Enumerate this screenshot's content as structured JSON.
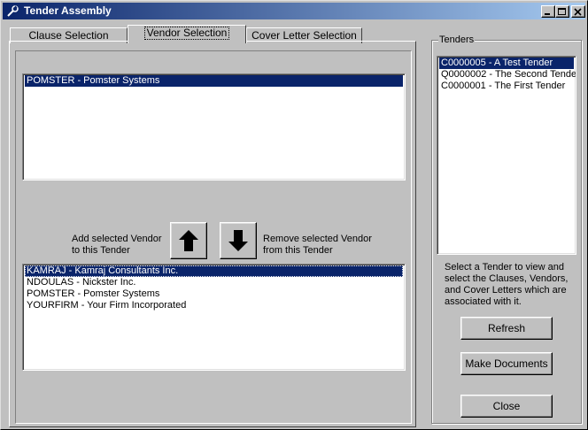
{
  "window": {
    "title": "Tender Assembly",
    "icon": "wrench-icon",
    "controls": {
      "minimize": "minimize-icon",
      "maximize": "maximize-icon",
      "close": "close-icon"
    }
  },
  "tabs": [
    {
      "label": "Clause Selection",
      "active": false
    },
    {
      "label": "Vendor Selection",
      "active": true
    },
    {
      "label": "Cover Letter Selection",
      "active": false
    }
  ],
  "vendor_tab": {
    "selected_vendors": [
      {
        "label": "POMSTER - Pomster Systems",
        "selected": true
      }
    ],
    "add_label_line1": "Add selected Vendor",
    "add_label_line2": "to this Tender",
    "remove_label_line1": "Remove selected Vendor",
    "remove_label_line2": "from this Tender",
    "add_button_icon": "arrow-up-icon",
    "remove_button_icon": "arrow-down-icon",
    "available_vendors": [
      {
        "label": "KAMRAJ - Kamraj Consultants Inc.",
        "selected": true
      },
      {
        "label": "NDOULAS - Nickster Inc.",
        "selected": false
      },
      {
        "label": "POMSTER - Pomster Systems",
        "selected": false
      },
      {
        "label": "YOURFIRM - Your Firm Incorporated",
        "selected": false
      }
    ]
  },
  "tenders": {
    "legend": "Tenders",
    "items": [
      {
        "label": "C0000005 - A Test Tender",
        "selected": true
      },
      {
        "label": "Q0000002 - The Second Tende",
        "selected": false
      },
      {
        "label": "C0000001 - The First Tender",
        "selected": false
      }
    ],
    "help_line1": "Select a Tender to view and",
    "help_line2": "select the Clauses, Vendors,",
    "help_line3": "and Cover Letters which are",
    "help_line4": "associated with it.",
    "refresh_label": "Refresh",
    "make_documents_label": "Make Documents",
    "close_label": "Close"
  },
  "colors": {
    "face": "#c0c0c0",
    "selection": "#0a246a",
    "title_gradient_start": "#0a246a",
    "title_gradient_end": "#a6caf0"
  }
}
